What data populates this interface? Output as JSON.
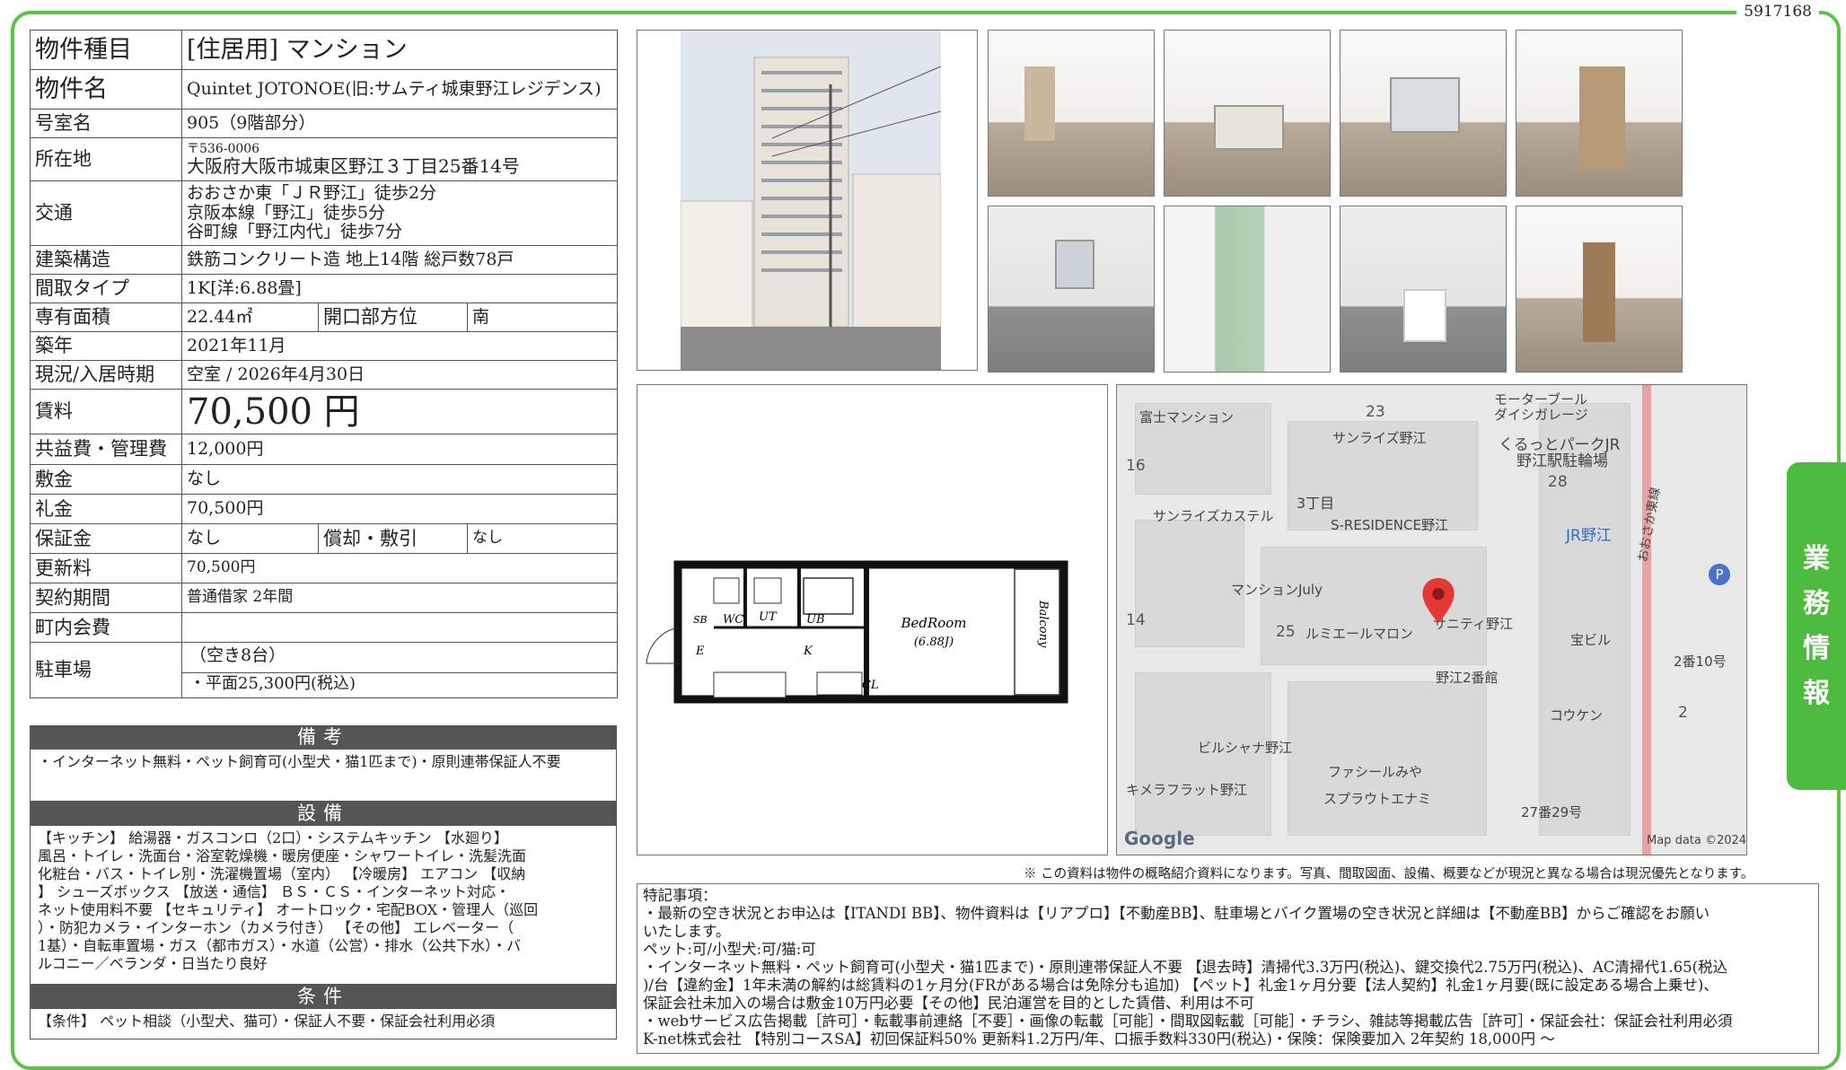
{
  "doc_id": "5917168",
  "property": {
    "type_label": "物件種目",
    "type_value": "[住居用] マンション",
    "name_label": "物件名",
    "name_value": "Quintet JOTONOE(旧:サムティ城東野江レジデンス)",
    "room_label": "号室名",
    "room_value": "905（9階部分）",
    "address_label": "所在地",
    "zip": "〒536-0006",
    "address": "大阪府大阪市城東区野江３丁目25番14号",
    "access_label": "交通",
    "access1": "おおさか東「ＪＲ野江」徒歩2分",
    "access2": "京阪本線「野江」徒歩5分",
    "access3": "谷町線「野江内代」徒歩7分",
    "structure_label": "建築構造",
    "structure_value": "鉄筋コンクリート造 地上14階 総戸数78戸",
    "layout_label": "間取タイプ",
    "layout_value": "1K[洋:6.88畳]",
    "area_label": "専有面積",
    "area_value": "22.44㎡",
    "direction_label": "開口部方位",
    "direction_value": "南",
    "built_label": "築年",
    "built_value": "2021年11月",
    "status_label": "現況/入居時期",
    "status_value": "空室 / 2026年4月30日",
    "rent_label": "賃料",
    "rent_value": "70,500 円",
    "fee_label": "共益費・管理費",
    "fee_value": "12,000円",
    "deposit_label": "敷金",
    "deposit_value": "なし",
    "keymoney_label": "礼金",
    "keymoney_value": "70,500円",
    "guarantee_label": "保証金",
    "guarantee_value": "なし",
    "amort_label": "償却・敷引",
    "amort_value": "なし",
    "renewal_label": "更新料",
    "renewal_value": "70,500円",
    "contract_label": "契約期間",
    "contract_value": "普通借家 2年間",
    "town_label": "町内会費",
    "town_value": "",
    "parking_label": "駐車場",
    "parking_value1": "（空き8台）",
    "parking_value2": "・平面25,300円(税込)"
  },
  "remarks": {
    "title": "備考",
    "text": "・インターネット無料・ペット飼育可(小型犬・猫1匹まで)・原則連帯保証人不要"
  },
  "equipment": {
    "title": "設備",
    "line1": "【キッチン】 給湯器・ガスコンロ（2口）・システムキッチン 【水廻り】",
    "line2": "風呂・トイレ・洗面台・浴室乾燥機・暖房便座・シャワートイレ・洗髪洗面",
    "line3": "化粧台・バス・トイレ別・洗濯機置場（室内） 【冷暖房】 エアコン 【収納",
    "line4": "】 シューズボックス 【放送・通信】 ＢＳ・ＣＳ・インターネット対応・",
    "line5": "ネット使用料不要 【セキュリティ】 オートロック・宅配BOX・管理人（巡回",
    "line6": "）・防犯カメラ・インターホン（カメラ付き） 【その他】 エレベーター（",
    "line7": "1基）・自転車置場・ガス（都市ガス）・水道（公営）・排水（公共下水）・バ",
    "line8": "ルコニー／ベランダ・日当たり良好"
  },
  "conditions": {
    "title": "条件",
    "text": "【条件】 ペット相談（小型犬、猫可）・保証人不要・保証会社利用必須"
  },
  "floorplan": {
    "bedroom": "BedRoom",
    "bedroom_size": "(6.88J)",
    "balcony": "Balcony",
    "ut": "UT",
    "ub": "UB",
    "wc": "WC",
    "sb": "SB",
    "e": "E",
    "k": "K",
    "cl": "CL"
  },
  "map": {
    "labels": {
      "fuji": "富士マンション",
      "motor": "モーターブール",
      "motor2": "ダイシガレージ",
      "sunrise": "サンライズ野江",
      "kurutto": "くるっとパークJR",
      "kurutto2": "野江駅駐輪場",
      "chome": "3丁目",
      "castle": "サンライズカステル",
      "sres": "S-RESIDENCE野江",
      "jr": "JR野江",
      "july": "マンションJuly",
      "lumiere": "ルミエールマロン",
      "sanity": "サニティ野江",
      "takara": "宝ビル",
      "noe2": "野江2番館",
      "no10": "2番10号",
      "kouken": "コウケン",
      "birushana": "ビルシャナ野江",
      "family": "ファシールみや",
      "kimera": "キメラフラット野江",
      "sprout": "スプラウトエナミ",
      "no29": "27番29号",
      "line": "おおさか東線",
      "google": "Google",
      "mapdata": "Map data ©2024"
    },
    "numbers": {
      "n23": "23",
      "n16": "16",
      "n28": "28",
      "n14": "14",
      "n25": "25",
      "n2": "2"
    }
  },
  "note": "※ この資料は物件の概略紹介資料になります。写真、間取図面、設備、概要などが現況と異なる場合は現況優先となります。",
  "special": {
    "l1": "特記事項：",
    "l2": "・最新の空き状況とお申込は【ITANDI BB】、物件資料は【リアプロ】【不動産BB】、駐車場とバイク置場の空き状況と詳細は【不動産BB】からご確認をお願い",
    "l3": "いたします。",
    "l4": "ペット:可/小型犬:可/猫:可",
    "l5": "・インターネット無料・ペット飼育可(小型犬・猫1匹まで)・原則連帯保証人不要 【退去時】清掃代3.3万円(税込)、鍵交換代2.75万円(税込)、AC清掃代1.65(税込",
    "l6": ")/台【違約金】1年未満の解約は総賃料の1ヶ月分(FRがある場合は免除分も追加) 【ペット】礼金1ヶ月分要【法人契約】礼金1ヶ月要(既に設定ある場合上乗せ)、",
    "l7": "保証会社未加入の場合は敷金10万円必要【その他】民泊運営を目的とした賃借、利用は不可",
    "l8": "・webサービス広告掲載［許可］・転載事前連絡［不要］・画像の転載［可能］・間取図転載［可能］・チラシ、雑誌等掲載広告［許可］・保証会社：保証会社利用必須",
    "l9": " K-net株式会社 【特別コースSA】初回保証料50% 更新料1.2万円/年、口振手数料330円(税込)・保険：保険要加入 2年契約 18,000円 〜"
  },
  "side_tab": {
    "c1": "業",
    "c2": "務",
    "c3": "情",
    "c4": "報"
  }
}
